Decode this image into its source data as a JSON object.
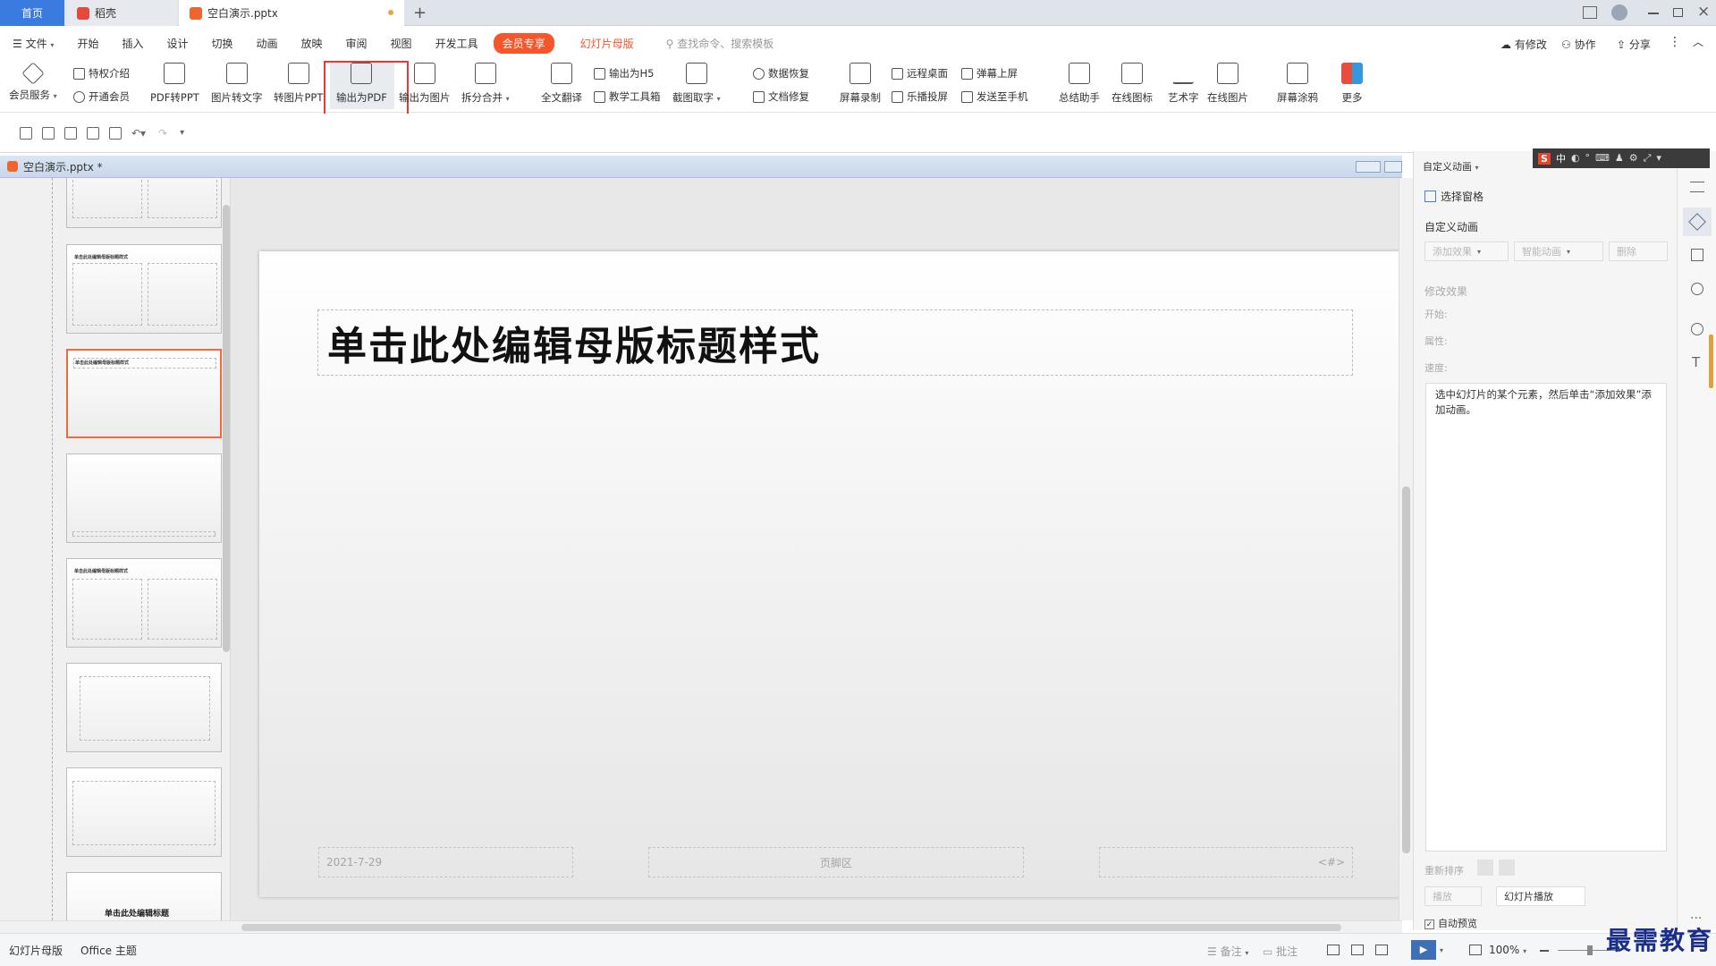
{
  "tabs": {
    "home": "首页",
    "docer": "稻壳",
    "doc": "空白演示.pptx",
    "new": "+"
  },
  "menu": {
    "file": "文件",
    "items": [
      "开始",
      "插入",
      "设计",
      "切换",
      "动画",
      "放映",
      "审阅",
      "视图",
      "开发工具"
    ],
    "vip": "会员专享",
    "master": "幻灯片母版",
    "search": "查找命令、搜索模板",
    "modify": "有修改",
    "collab": "协作",
    "share": "分享"
  },
  "ribbon": {
    "vip_service": "会员服务",
    "privilege": "特权介绍",
    "open_vip": "开通会员",
    "pdf2ppt": "PDF转PPT",
    "img2text": "图片转文字",
    "img2ppt": "转图片PPT",
    "to_pdf": "输出为PDF",
    "to_image": "输出为图片",
    "split_merge": "拆分合并",
    "translate": "全文翻译",
    "to_h5": "输出为H5",
    "teach_tools": "教学工具箱",
    "crop_text": "截图取字",
    "data_recover": "数据恢复",
    "doc_repair": "文档修复",
    "screen_record": "屏幕录制",
    "remote_desktop": "远程桌面",
    "cast": "乐播投屏",
    "barrage": "弹幕上屏",
    "send_phone": "发送至手机",
    "summary": "总结助手",
    "online_icon": "在线图标",
    "wordart": "艺术字",
    "online_pic": "在线图片",
    "screen_draw": "屏幕涂鸦",
    "more": "更多"
  },
  "doc_title": "空白演示.pptx *",
  "slide": {
    "title": "单击此处编辑母版标题样式",
    "date": "2021-7-29",
    "footer": "页脚区",
    "number": "<#>"
  },
  "thumb_text": {
    "title": "单击此处编辑母版标题样式",
    "last": "单击此处编辑标题"
  },
  "panel": {
    "header": "自定义动画",
    "select_pane": "选择窗格",
    "section": "自定义动画",
    "add_effect": "添加效果",
    "smart_anim": "智能动画",
    "delete": "删除",
    "modify": "修改效果",
    "start": "开始:",
    "prop": "属性:",
    "speed": "速度:",
    "hint": "选中幻灯片的某个元素，然后单击“添加效果”添加动画。",
    "reorder": "重新排序",
    "play": "播放",
    "slideshow": "幻灯片播放",
    "autopreview": "自动预览"
  },
  "status": {
    "mode": "幻灯片母版",
    "theme": "Office 主题",
    "notes": "备注",
    "comments": "批注",
    "zoom": "100%"
  },
  "ime": "中",
  "watermark": "最需教育",
  "colors": {
    "accent": "#3a7be0",
    "vip": "#f5562b",
    "selection": "#f06a3c",
    "highlight": "#e53935"
  }
}
